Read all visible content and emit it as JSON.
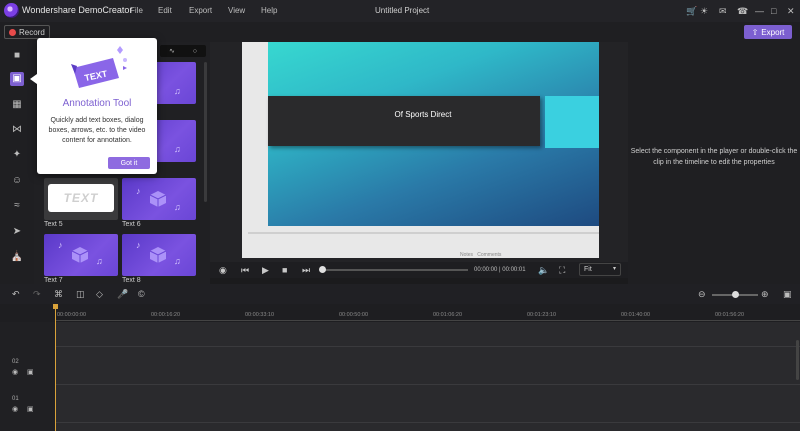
{
  "app": {
    "name": "Wondershare DemoCreator",
    "window_title": "Untitled Project",
    "menus": [
      "File",
      "Edit",
      "Export",
      "View",
      "Help"
    ],
    "titlebar_icons": [
      "cart-icon",
      "gift-icon",
      "mail-icon",
      "headset-icon",
      "minimize-icon",
      "maximize-icon",
      "close-icon"
    ]
  },
  "toolbar": {
    "record_label": "Record",
    "export_label": "Export"
  },
  "library": {
    "items": [
      {
        "label": "Text 5"
      },
      {
        "label": "Text 6"
      },
      {
        "label": "Text 7"
      },
      {
        "label": "Text 8"
      }
    ],
    "text5_preview": "TEXT"
  },
  "popup": {
    "badge_text": "TEXT",
    "title": "Annotation Tool",
    "description": "Quickly add text boxes, dialog boxes, arrows, etc. to the video content for annotation.",
    "button": "Got it"
  },
  "preview": {
    "caption": "Of Sports Direct",
    "notes_label": "Notes",
    "comments_label": "Comments",
    "timecode": "00:00:00 | 00:00:01",
    "zoom": "Fit"
  },
  "properties": {
    "message": "Select the component in the player or double-click the clip in the timeline to edit the properties"
  },
  "timeline": {
    "ticks": [
      "00:00:00:00",
      "00:00:16:20",
      "00:00:33:10",
      "00:00:50:00",
      "00:01:06:20",
      "00:01:23:10",
      "00:01:40:00",
      "00:01:56:20"
    ],
    "tracks": [
      {
        "number": "02"
      },
      {
        "number": "01"
      }
    ]
  },
  "colors": {
    "accent": "#7c5fd0",
    "record": "#e84b4b",
    "playhead": "#d9a23a"
  }
}
